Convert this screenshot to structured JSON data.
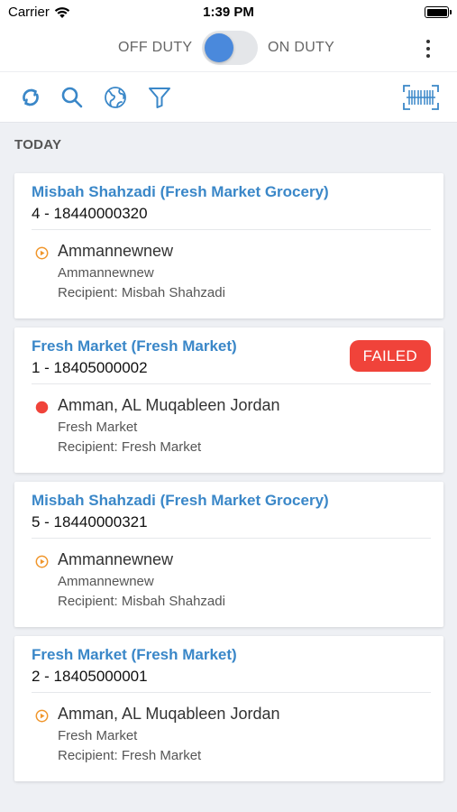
{
  "status_bar": {
    "carrier": "Carrier",
    "time": "1:39 PM"
  },
  "duty": {
    "off_label": "OFF DUTY",
    "on_label": "ON DUTY"
  },
  "toolbar": {
    "icons": [
      "refresh-icon",
      "search-icon",
      "globe-icon",
      "filter-icon",
      "barcode-scan-icon"
    ]
  },
  "section": {
    "title": "TODAY"
  },
  "colors": {
    "accent": "#3a87c8",
    "toggle_knob": "#4a89dc",
    "failed_badge": "#f0433a",
    "pending_marker": "#f0962c",
    "failed_marker": "#f0433a"
  },
  "orders": [
    {
      "title": "Misbah Shahzadi (Fresh Market Grocery)",
      "id_line": "4 - 18440000320",
      "address": "Ammannewnew",
      "sub": "Ammannewnew",
      "recipient": "Recipient: Misbah Shahzadi",
      "marker": "pending-marker-icon",
      "badge": ""
    },
    {
      "title": "Fresh Market (Fresh Market)",
      "id_line": "1 - 18405000002",
      "address": "Amman, AL Muqableen Jordan",
      "sub": "Fresh Market",
      "recipient": "Recipient: Fresh Market",
      "marker": "failed-marker-icon",
      "badge": "FAILED"
    },
    {
      "title": "Misbah Shahzadi (Fresh Market Grocery)",
      "id_line": "5 - 18440000321",
      "address": "Ammannewnew",
      "sub": "Ammannewnew",
      "recipient": "Recipient: Misbah Shahzadi",
      "marker": "pending-marker-icon",
      "badge": ""
    },
    {
      "title": "Fresh Market (Fresh Market)",
      "id_line": "2 - 18405000001",
      "address": "Amman, AL Muqableen Jordan",
      "sub": "Fresh Market",
      "recipient": "Recipient: Fresh Market",
      "marker": "pending-marker-icon",
      "badge": ""
    }
  ]
}
